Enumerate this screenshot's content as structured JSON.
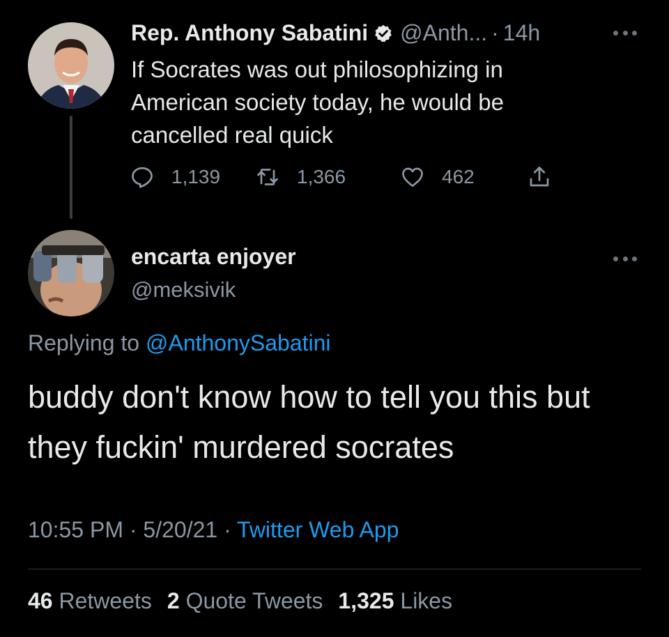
{
  "tweet1": {
    "name": "Rep. Anthony Sabatini",
    "handle": "@Anth...",
    "separator": "·",
    "time": "14h",
    "text": "If Socrates was out philosophizing in American society today, he would be cancelled real quick",
    "replies": "1,139",
    "retweets": "1,366",
    "likes": "462",
    "verified": true
  },
  "tweet2": {
    "name": "encarta enjoyer",
    "handle": "@meksivik",
    "replying_prefix": "Replying to",
    "replying_mention": "@AnthonySabatini",
    "text": "buddy don't know how to tell you this but they fuckin' murdered socrates",
    "time": "10:55 PM",
    "date": "5/20/21",
    "source": "Twitter Web App",
    "separator": "·"
  },
  "stats": {
    "retweets_count": "46",
    "retweets_label": "Retweets",
    "quotes_count": "2",
    "quotes_label": "Quote Tweets",
    "likes_count": "1,325",
    "likes_label": "Likes"
  },
  "icons": {
    "verified": "verified-badge-icon",
    "more": "more-horizontal-icon",
    "reply": "reply-icon",
    "retweet": "retweet-icon",
    "like": "heart-icon",
    "share": "share-icon"
  },
  "colors": {
    "background": "#000000",
    "text": "#e7e9ea",
    "muted": "#8b98a5",
    "accent": "#1d9bf0"
  }
}
